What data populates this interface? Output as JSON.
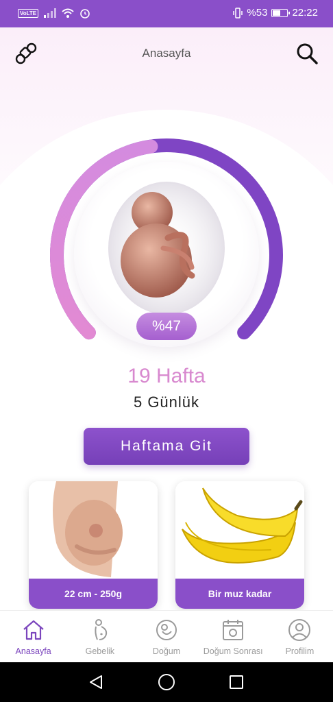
{
  "status_bar": {
    "volte": "VoLTE",
    "battery": "%53",
    "time": "22:22",
    "battery_level": 0.53
  },
  "header": {
    "title": "Anasayfa",
    "left_icon": "pacifier-icon",
    "right_icon": "search-icon"
  },
  "progress": {
    "percent_label": "%47",
    "fraction": 0.47
  },
  "pregnancy": {
    "week": "19 Hafta",
    "days": "5 Günlük"
  },
  "go_button": {
    "label": "Haftama Git"
  },
  "cards": [
    {
      "label": "22 cm - 250g",
      "icon": "belly-image"
    },
    {
      "label": "Bir muz kadar",
      "icon": "banana-image"
    }
  ],
  "nav": [
    {
      "label": "Anasayfa",
      "icon": "home-icon",
      "active": true
    },
    {
      "label": "Gebelik",
      "icon": "pregnancy-icon",
      "active": false
    },
    {
      "label": "Doğum",
      "icon": "birth-icon",
      "active": false
    },
    {
      "label": "Doğum Sonrası",
      "icon": "calendar-baby-icon",
      "active": false
    },
    {
      "label": "Profilim",
      "icon": "profile-icon",
      "active": false
    }
  ],
  "colors": {
    "primary": "#8a4fc9",
    "accent_pink": "#d889cf"
  }
}
